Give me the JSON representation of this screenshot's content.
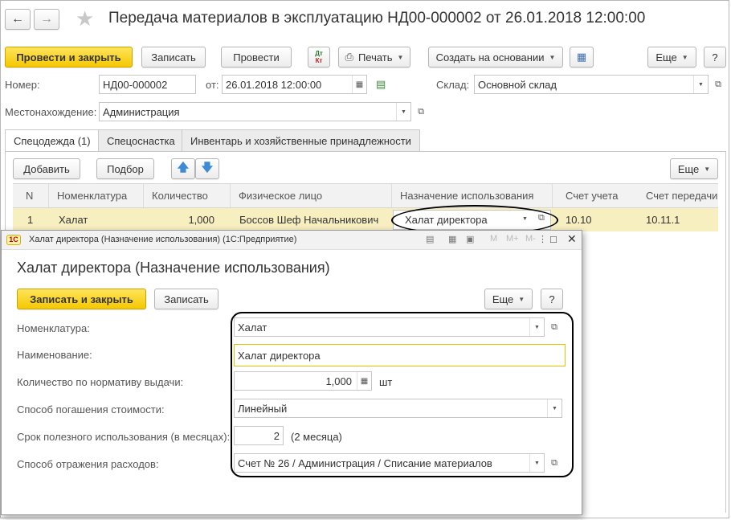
{
  "window": {
    "title": "Передача материалов в эксплуатацию НД00-000002 от 26.01.2018 12:00:00"
  },
  "toolbar": {
    "post_close": "Провести и закрыть",
    "save": "Записать",
    "post": "Провести",
    "dtkt_top": "Дт",
    "dtkt_bottom": "Кт",
    "print": "Печать",
    "create_based": "Создать на основании",
    "more": "Еще",
    "help": "?"
  },
  "header": {
    "number_label": "Номер:",
    "number_value": "НД00-000002",
    "from_label": "от:",
    "date_value": "26.01.2018 12:00:00",
    "warehouse_label": "Склад:",
    "warehouse_value": "Основной склад",
    "location_label": "Местонахождение:",
    "location_value": "Администрация"
  },
  "tabs": [
    {
      "label": "Спецодежда (1)",
      "active": true
    },
    {
      "label": "Спецоснастка",
      "active": false
    },
    {
      "label": "Инвентарь и хозяйственные принадлежности",
      "active": false
    }
  ],
  "table_toolbar": {
    "add": "Добавить",
    "select": "Подбор",
    "more": "Еще"
  },
  "table": {
    "columns": [
      "N",
      "Номенклатура",
      "Количество",
      "Физическое лицо",
      "Назначение использования",
      "Счет учета",
      "Счет передачи"
    ],
    "rows": [
      {
        "n": "1",
        "item": "Халат",
        "qty": "1,000",
        "person": "Боссов Шеф Начальникович",
        "purpose": "Халат директора",
        "account": "10.10",
        "transfer_account": "10.11.1"
      }
    ]
  },
  "dialog": {
    "window_title": "Халат директора (Назначение использования) (1С:Предприятие)",
    "heading": "Халат директора (Назначение использования)",
    "save_close": "Записать и закрыть",
    "save": "Записать",
    "more": "Еще",
    "help": "?",
    "tb_m": "M",
    "tb_mplus": "M+",
    "tb_mminus": "M-",
    "fields": {
      "nomenclature_label": "Номенклатура:",
      "nomenclature_value": "Халат",
      "name_label": "Наименование:",
      "name_value": "Халат директора",
      "qty_label": "Количество по нормативу выдачи:",
      "qty_value": "1,000",
      "qty_unit": "шт",
      "method_label": "Способ погашения стоимости:",
      "method_value": "Линейный",
      "term_label": "Срок полезного использования (в месяцах):",
      "term_value": "2",
      "term_hint": "(2 месяца)",
      "expense_label": "Способ отражения расходов:",
      "expense_value": "Счет № 26 / Администрация / Списание материалов"
    }
  },
  "colors": {
    "accent_yellow": "#f5c800",
    "row_highlight": "#f7efc0",
    "arrow_blue": "#3d8ad6"
  }
}
